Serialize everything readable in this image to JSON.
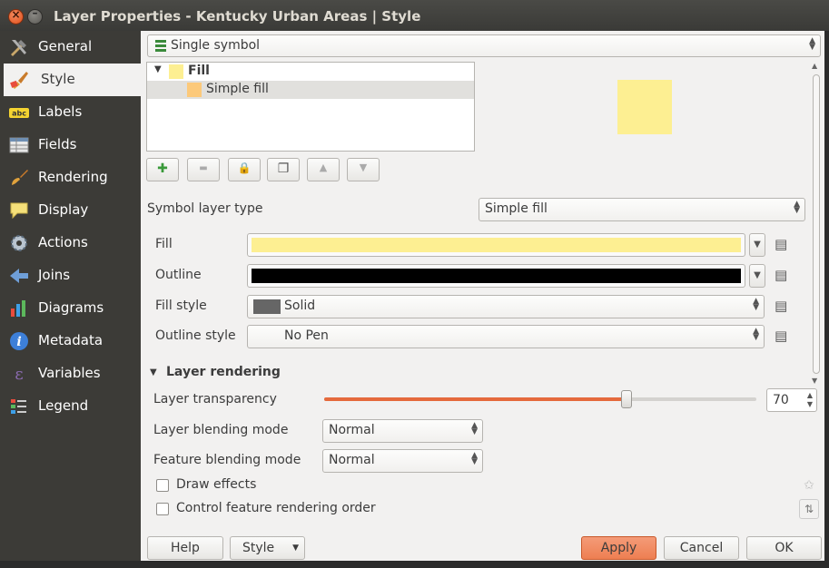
{
  "window": {
    "title": "Layer Properties - Kentucky Urban Areas | Style",
    "close_glyph": "×",
    "min_glyph": "–"
  },
  "sidebar": {
    "items": [
      {
        "label": "General",
        "icon": "tools-icon"
      },
      {
        "label": "Style",
        "icon": "paintbrush-icon",
        "active": true
      },
      {
        "label": "Labels",
        "icon": "abc-label-icon",
        "badge": "abc"
      },
      {
        "label": "Fields",
        "icon": "table-icon"
      },
      {
        "label": "Rendering",
        "icon": "brush-icon"
      },
      {
        "label": "Display",
        "icon": "speech-bubble-icon"
      },
      {
        "label": "Actions",
        "icon": "gear-icon"
      },
      {
        "label": "Joins",
        "icon": "join-arrow-icon"
      },
      {
        "label": "Diagrams",
        "icon": "chart-icon"
      },
      {
        "label": "Metadata",
        "icon": "info-icon",
        "badge": "i"
      },
      {
        "label": "Variables",
        "icon": "epsilon-icon",
        "badge": "ε"
      },
      {
        "label": "Legend",
        "icon": "legend-icon"
      }
    ]
  },
  "renderer": {
    "mode": "Single symbol"
  },
  "symbol_tree": {
    "root": {
      "label": "Fill",
      "expand_glyph": "▼"
    },
    "child": {
      "label": "Simple fill"
    }
  },
  "colors": {
    "fill": "#fdef92",
    "outline": "#000000",
    "accent": "#e56a3c",
    "swatch_child": "#fcc97a"
  },
  "tool_buttons": [
    {
      "name": "add-layer-icon",
      "glyph": "✚"
    },
    {
      "name": "remove-layer-icon",
      "glyph": "▬"
    },
    {
      "name": "lock-icon",
      "glyph": "🔒"
    },
    {
      "name": "duplicate-icon",
      "glyph": "❐"
    },
    {
      "name": "move-up-icon",
      "glyph": "▲"
    },
    {
      "name": "move-down-icon",
      "glyph": "▼"
    }
  ],
  "symbol_layer_type": {
    "label": "Symbol layer type",
    "value": "Simple fill"
  },
  "props": {
    "fill_label": "Fill",
    "outline_label": "Outline",
    "fill_style_label": "Fill style",
    "fill_style_value": "Solid",
    "outline_style_label": "Outline style",
    "outline_style_value": "No Pen"
  },
  "layer_rendering": {
    "title": "Layer rendering",
    "transparency_label": "Layer transparency",
    "transparency_value": "70",
    "blending_label": "Layer blending mode",
    "blending_value": "Normal",
    "feature_blending_label": "Feature blending mode",
    "feature_blending_value": "Normal",
    "draw_effects_label": "Draw effects",
    "control_order_label": "Control feature rendering order"
  },
  "buttons": {
    "help": "Help",
    "style": "Style",
    "apply": "Apply",
    "cancel": "Cancel",
    "ok": "OK"
  }
}
